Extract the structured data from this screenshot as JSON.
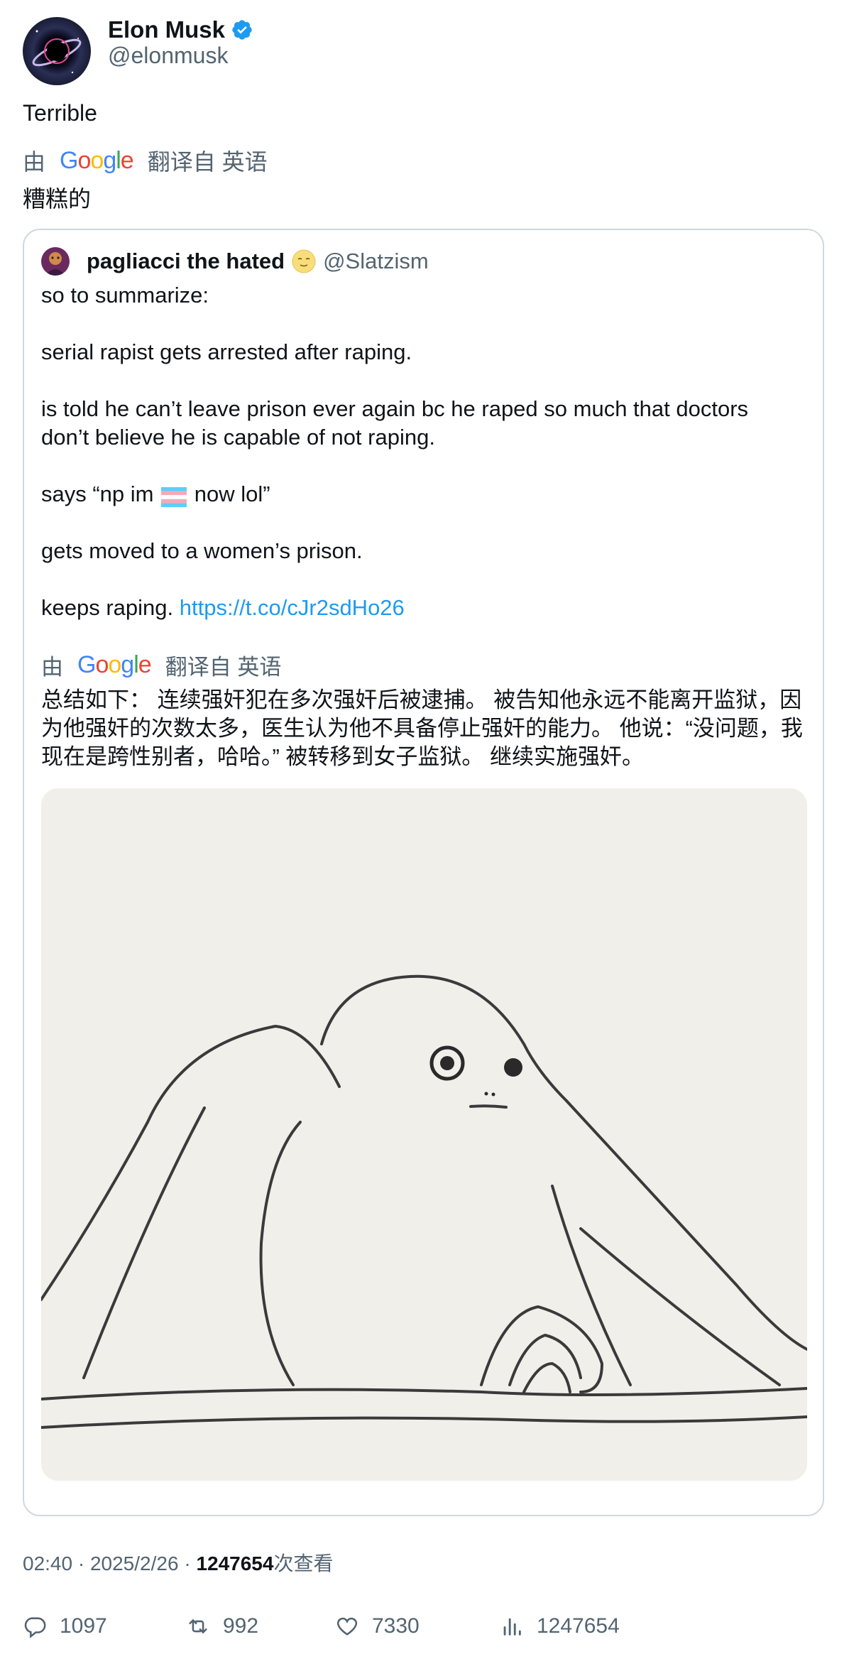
{
  "author": {
    "name": "Elon Musk",
    "handle": "@elonmusk",
    "verified": true,
    "verified_color": "#1d9bf0"
  },
  "tweet": {
    "text": "Terrible",
    "translation_prefix": "由",
    "translation_brand": "Google",
    "translation_suffix": "翻译自 英语",
    "translated_text": "糟糕的"
  },
  "quote": {
    "name": "pagliacci the hated",
    "name_emoji": "moon-face-emoji",
    "handle": "@Slatzism",
    "lines": [
      "so to summarize:",
      "serial rapist gets arrested after raping.",
      "is told he can’t leave prison ever again bc he raped so much that doctors",
      "don’t believe he is capable of not raping.",
      "says “np im",
      "now lol”",
      "gets moved to a women’s prison.",
      "keeps raping."
    ],
    "link": "https://t.co/cJr2sdHo26",
    "flag_icon": "transgender-flag-icon",
    "translation_prefix": "由",
    "translation_brand": "Google",
    "translation_suffix": "翻译自 英语",
    "translated_text": "总结如下： 连续强奸犯在多次强奸后被逮捕。 被告知他永远不能离开监狱，因为他强奸的次数太多，医生认为他不具备停止强奸的能力。 他说：“没问题，我现在是跨性别者，哈哈。” 被转移到女子监狱。 继续实施强奸。",
    "image_icon": "sketch-drawing-image"
  },
  "meta": {
    "time": "02:40",
    "separator": "·",
    "date": "2025/2/26",
    "views": "1247654",
    "views_label": "次查看"
  },
  "actions": {
    "replies": "1097",
    "retweets": "992",
    "likes": "7330",
    "views": "1247654"
  },
  "colors": {
    "text": "#0f1419",
    "secondary": "#536471",
    "link": "#1d9bf0",
    "border": "#cfd9de"
  }
}
